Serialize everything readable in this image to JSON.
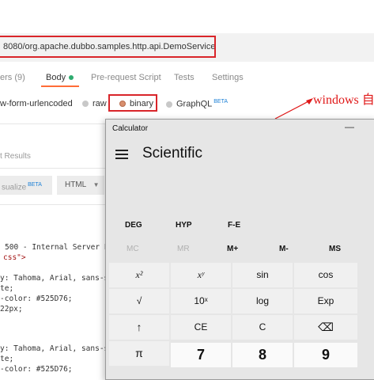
{
  "url": "8080/org.apache.dubbo.samples.http.api.DemoService",
  "tabs": {
    "headers": "ers (9)",
    "body": "Body",
    "prerequest": "Pre-request Script",
    "tests": "Tests",
    "settings": "Settings"
  },
  "body_options": {
    "urlencoded": "w-form-urlencoded",
    "raw": "raw",
    "binary": "binary",
    "graphql": "GraphQL",
    "beta": "BETA"
  },
  "response": {
    "results_label": "t Results",
    "visualize_label": "sualize",
    "visualize_beta": "BETA",
    "format": "HTML",
    "code_lines": [
      "500 - Internal Server E",
      "css\">",
      "y: Tahoma, Arial, sans-s",
      "te;",
      "-color: #525D76;",
      " 22px;",
      "y: Tahoma, Arial, sans-s",
      "te;",
      "-color: #525D76;"
    ]
  },
  "annotation": "windows 自",
  "calculator": {
    "title": "Calculator",
    "minimize": "—",
    "mode": "Scientific",
    "angle_row": [
      "DEG",
      "HYP",
      "F-E"
    ],
    "memory_row": [
      "MC",
      "MR",
      "M+",
      "M-",
      "MS"
    ],
    "keys": [
      [
        "x²",
        "xʸ",
        "sin",
        "cos"
      ],
      [
        "√",
        "10ˣ",
        "log",
        "Exp"
      ],
      [
        "↑",
        "CE",
        "C",
        "⌫"
      ],
      [
        "π",
        "7",
        "8",
        "9"
      ]
    ]
  }
}
